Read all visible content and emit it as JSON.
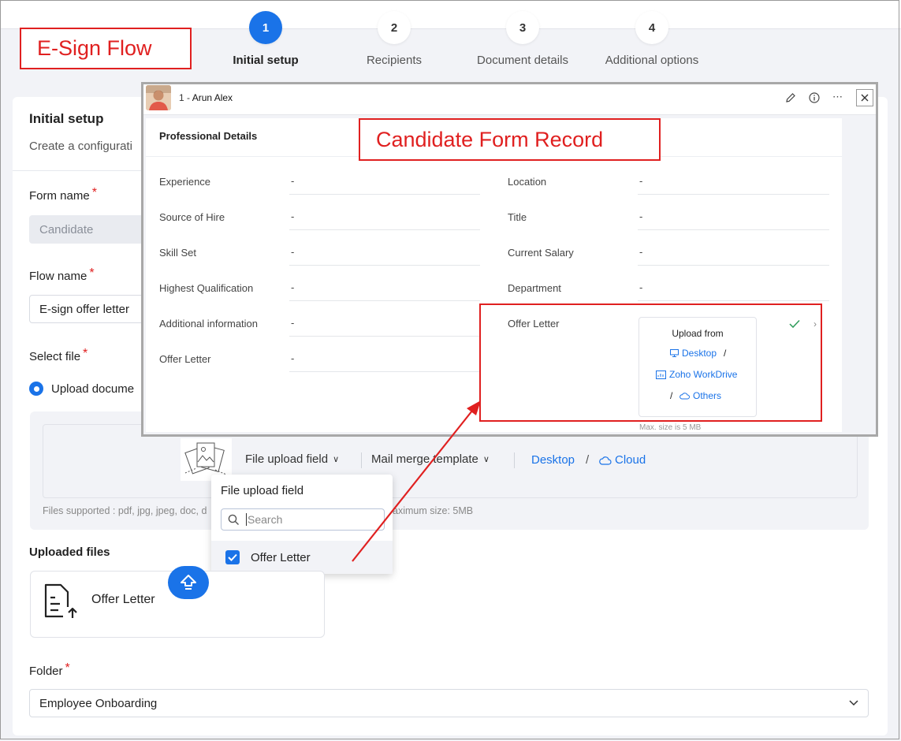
{
  "annotations": {
    "esign_flow": "E-Sign Flow",
    "candidate_form_record": "Candidate Form Record"
  },
  "steps": [
    {
      "num": "1",
      "label": "Initial setup"
    },
    {
      "num": "2",
      "label": "Recipients"
    },
    {
      "num": "3",
      "label": "Document details"
    },
    {
      "num": "4",
      "label": "Additional options"
    }
  ],
  "form": {
    "title": "Initial setup",
    "subtitle": "Create a configurati",
    "form_name_label": "Form name",
    "form_name_value": "Candidate",
    "flow_name_label": "Flow name",
    "flow_name_value": "E-sign offer letter",
    "select_file_label": "Select file",
    "upload_option": "Upload docume",
    "required_mark": "*"
  },
  "upload": {
    "file_upload_field": "File upload field",
    "mail_merge_template": "Mail merge template",
    "desktop": "Desktop",
    "separator": "/",
    "cloud": "Cloud",
    "files_supported": "Files supported : pdf, jpg, jpeg, doc, d",
    "max_size": "aximum size: 5MB"
  },
  "dropdown": {
    "title": "File upload field",
    "search_placeholder": "Search",
    "option": "Offer Letter"
  },
  "uploaded": {
    "title": "Uploaded files",
    "file_name": "Offer Letter"
  },
  "folder": {
    "label": "Folder",
    "value": "Employee Onboarding"
  },
  "record": {
    "prefix": "1 - ",
    "name": "Arun Alex",
    "section": "Professional Details",
    "left_fields": [
      {
        "label": "Experience",
        "value": "-"
      },
      {
        "label": "Source of Hire",
        "value": "-"
      },
      {
        "label": "Skill Set",
        "value": "-"
      },
      {
        "label": "Highest Qualification",
        "value": "-"
      },
      {
        "label": "Additional information",
        "value": "-"
      },
      {
        "label": "Offer Letter",
        "value": "-"
      }
    ],
    "right_fields": [
      {
        "label": "Location",
        "value": "-"
      },
      {
        "label": "Title",
        "value": "-"
      },
      {
        "label": "Current Salary",
        "value": "-"
      },
      {
        "label": "Department",
        "value": "-"
      }
    ],
    "offer_letter_label": "Offer Letter",
    "upload_from": "Upload from",
    "desktop": "Desktop",
    "workdrive": "Zoho WorkDrive",
    "others": "Others",
    "slash": "/",
    "max_size": "Max. size is 5 MB"
  },
  "colors": {
    "accent": "#1a73e8",
    "annotation": "#e02020",
    "required": "#e02020"
  }
}
